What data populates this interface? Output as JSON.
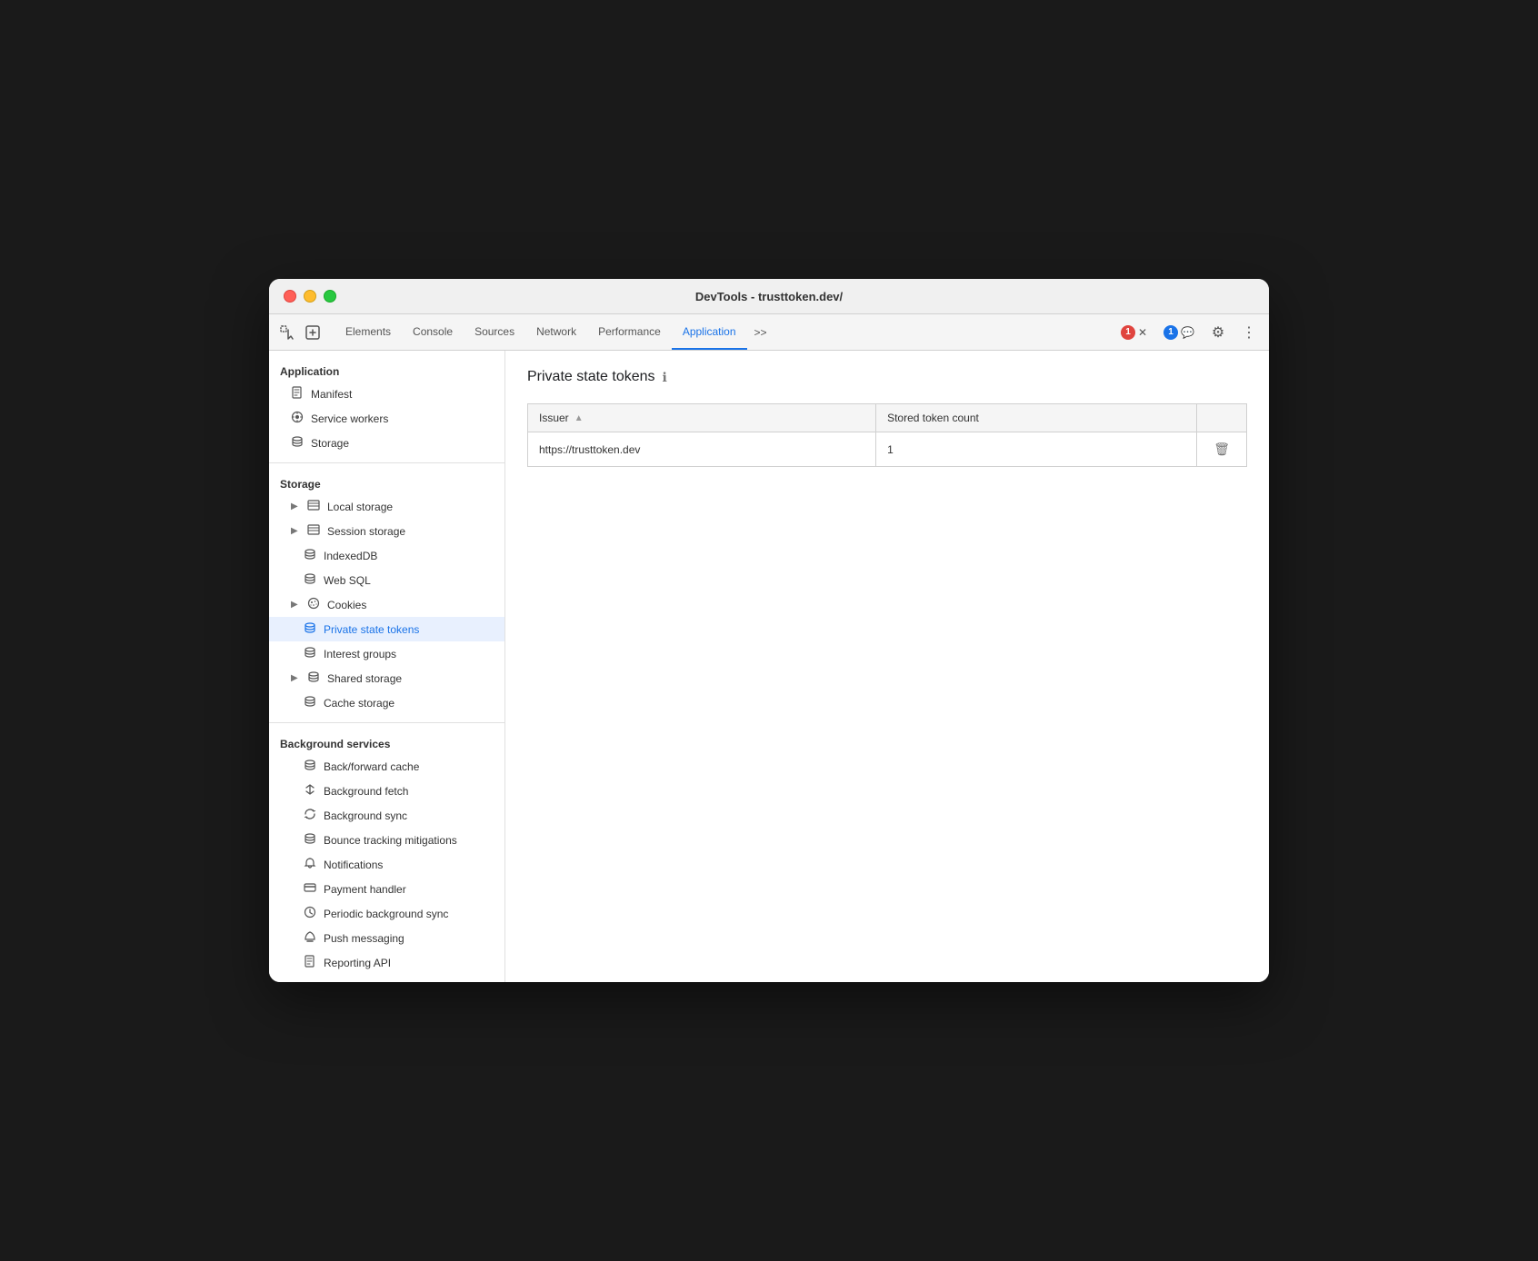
{
  "window": {
    "title": "DevTools - trusttoken.dev/"
  },
  "tabs": {
    "items": [
      {
        "id": "elements",
        "label": "Elements",
        "active": false
      },
      {
        "id": "console",
        "label": "Console",
        "active": false
      },
      {
        "id": "sources",
        "label": "Sources",
        "active": false
      },
      {
        "id": "network",
        "label": "Network",
        "active": false
      },
      {
        "id": "performance",
        "label": "Performance",
        "active": false
      },
      {
        "id": "application",
        "label": "Application",
        "active": true
      }
    ],
    "more_label": ">>",
    "error_count": "1",
    "warning_count": "1"
  },
  "sidebar": {
    "sections": [
      {
        "id": "application",
        "label": "Application",
        "items": [
          {
            "id": "manifest",
            "label": "Manifest",
            "icon": "📄",
            "indent": 1,
            "expand": false
          },
          {
            "id": "service-workers",
            "label": "Service workers",
            "icon": "⚙",
            "indent": 1,
            "expand": false
          },
          {
            "id": "storage",
            "label": "Storage",
            "icon": "🗄",
            "indent": 1,
            "expand": false
          }
        ]
      },
      {
        "id": "storage",
        "label": "Storage",
        "items": [
          {
            "id": "local-storage",
            "label": "Local storage",
            "icon": "▦",
            "indent": 1,
            "expand": true
          },
          {
            "id": "session-storage",
            "label": "Session storage",
            "icon": "▦",
            "indent": 1,
            "expand": true
          },
          {
            "id": "indexeddb",
            "label": "IndexedDB",
            "icon": "🗄",
            "indent": 1,
            "expand": false
          },
          {
            "id": "web-sql",
            "label": "Web SQL",
            "icon": "🗄",
            "indent": 1,
            "expand": false
          },
          {
            "id": "cookies",
            "label": "Cookies",
            "icon": "🍪",
            "indent": 1,
            "expand": true
          },
          {
            "id": "private-state-tokens",
            "label": "Private state tokens",
            "icon": "🗄",
            "indent": 1,
            "expand": false,
            "active": true
          },
          {
            "id": "interest-groups",
            "label": "Interest groups",
            "icon": "🗄",
            "indent": 1,
            "expand": false
          },
          {
            "id": "shared-storage",
            "label": "Shared storage",
            "icon": "🗄",
            "indent": 1,
            "expand": true
          },
          {
            "id": "cache-storage",
            "label": "Cache storage",
            "icon": "🗄",
            "indent": 1,
            "expand": false
          }
        ]
      },
      {
        "id": "background-services",
        "label": "Background services",
        "items": [
          {
            "id": "back-forward-cache",
            "label": "Back/forward cache",
            "icon": "🗄",
            "indent": 1,
            "expand": false
          },
          {
            "id": "background-fetch",
            "label": "Background fetch",
            "icon": "↕",
            "indent": 1,
            "expand": false
          },
          {
            "id": "background-sync",
            "label": "Background sync",
            "icon": "↺",
            "indent": 1,
            "expand": false
          },
          {
            "id": "bounce-tracking",
            "label": "Bounce tracking mitigations",
            "icon": "🗄",
            "indent": 1,
            "expand": false
          },
          {
            "id": "notifications",
            "label": "Notifications",
            "icon": "🔔",
            "indent": 1,
            "expand": false
          },
          {
            "id": "payment-handler",
            "label": "Payment handler",
            "icon": "💳",
            "indent": 1,
            "expand": false
          },
          {
            "id": "periodic-background-sync",
            "label": "Periodic background sync",
            "icon": "🕐",
            "indent": 1,
            "expand": false
          },
          {
            "id": "push-messaging",
            "label": "Push messaging",
            "icon": "☁",
            "indent": 1,
            "expand": false
          },
          {
            "id": "reporting-api",
            "label": "Reporting API",
            "icon": "📄",
            "indent": 1,
            "expand": false
          }
        ]
      }
    ]
  },
  "panel": {
    "title": "Private state tokens",
    "info_tooltip": "ℹ",
    "table": {
      "columns": [
        {
          "id": "issuer",
          "label": "Issuer",
          "sortable": true
        },
        {
          "id": "token-count",
          "label": "Stored token count",
          "sortable": false
        },
        {
          "id": "actions",
          "label": "",
          "sortable": false
        }
      ],
      "rows": [
        {
          "issuer": "https://trusttoken.dev",
          "token_count": "1"
        }
      ]
    }
  }
}
